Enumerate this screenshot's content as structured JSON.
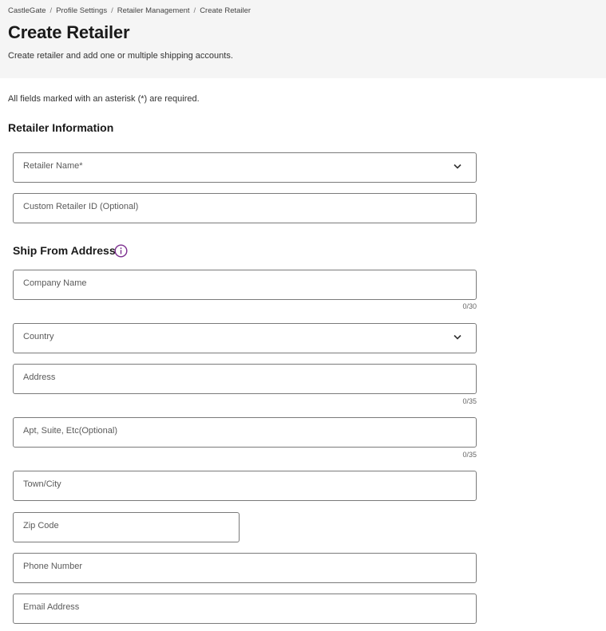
{
  "breadcrumb": [
    "CastleGate",
    "Profile Settings",
    "Retailer Management",
    "Create Retailer"
  ],
  "header": {
    "title": "Create Retailer",
    "subtitle": "Create retailer and add one or multiple shipping accounts."
  },
  "required_note": "All fields marked with an asterisk (*) are required.",
  "retailer_section": {
    "title": "Retailer Information",
    "retailer_name_label": "Retailer Name*",
    "custom_id_label": "Custom Retailer ID (Optional)"
  },
  "ship_section": {
    "title": "Ship From Address",
    "info_icon": "info-icon",
    "company_label": "Company Name",
    "company_counter": "0/30",
    "country_label": "Country",
    "address_label": "Address",
    "address_counter": "0/35",
    "apt_label": "Apt, Suite, Etc(Optional)",
    "apt_counter": "0/35",
    "town_label": "Town/City",
    "zip_label": "Zip Code",
    "phone_label": "Phone Number",
    "email_label": "Email Address"
  },
  "colors": {
    "header_bg": "#f5f5f5",
    "field_border": "#7a7a7a",
    "info_icon": "#7b2d8e"
  }
}
